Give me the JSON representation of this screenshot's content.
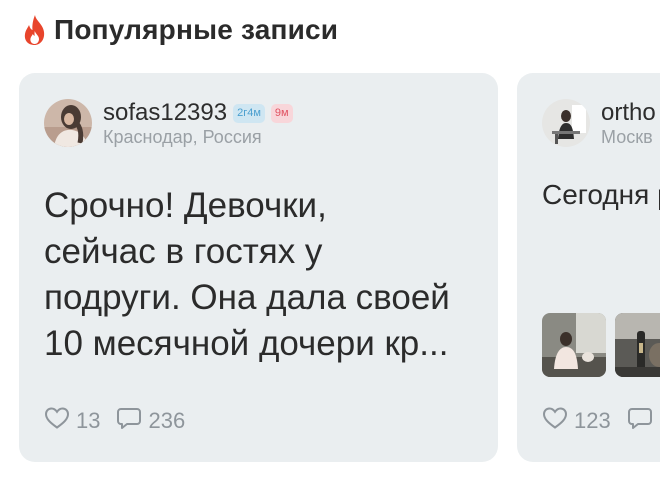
{
  "section": {
    "title": "Популярные записи",
    "icon": "fire-icon",
    "icon_color": "#e8452c"
  },
  "posts": [
    {
      "username": "sofas12393",
      "age_badge": "2г4м",
      "time_badge": "9м",
      "location": "Краснодар, Россия",
      "text": "Срочно! Девочки,\nсейчас в гостях у\nподруги. Она дала своей\n10 месячной дочери кр...",
      "likes": "13",
      "comments": "236"
    },
    {
      "username": "ortho",
      "location": "Москв",
      "text": "Сегодня\nрожден\nорганиз",
      "likes": "123",
      "thumbnails": [
        "photo-thumbnail",
        "photo-thumbnail"
      ]
    }
  ],
  "colors": {
    "card_bg": "#eaeef0",
    "age_badge_bg": "#cfe6f2",
    "age_badge_text": "#4a9fcf",
    "time_badge_bg": "#f8d6da",
    "time_badge_text": "#e05262",
    "muted": "#8e959b"
  }
}
